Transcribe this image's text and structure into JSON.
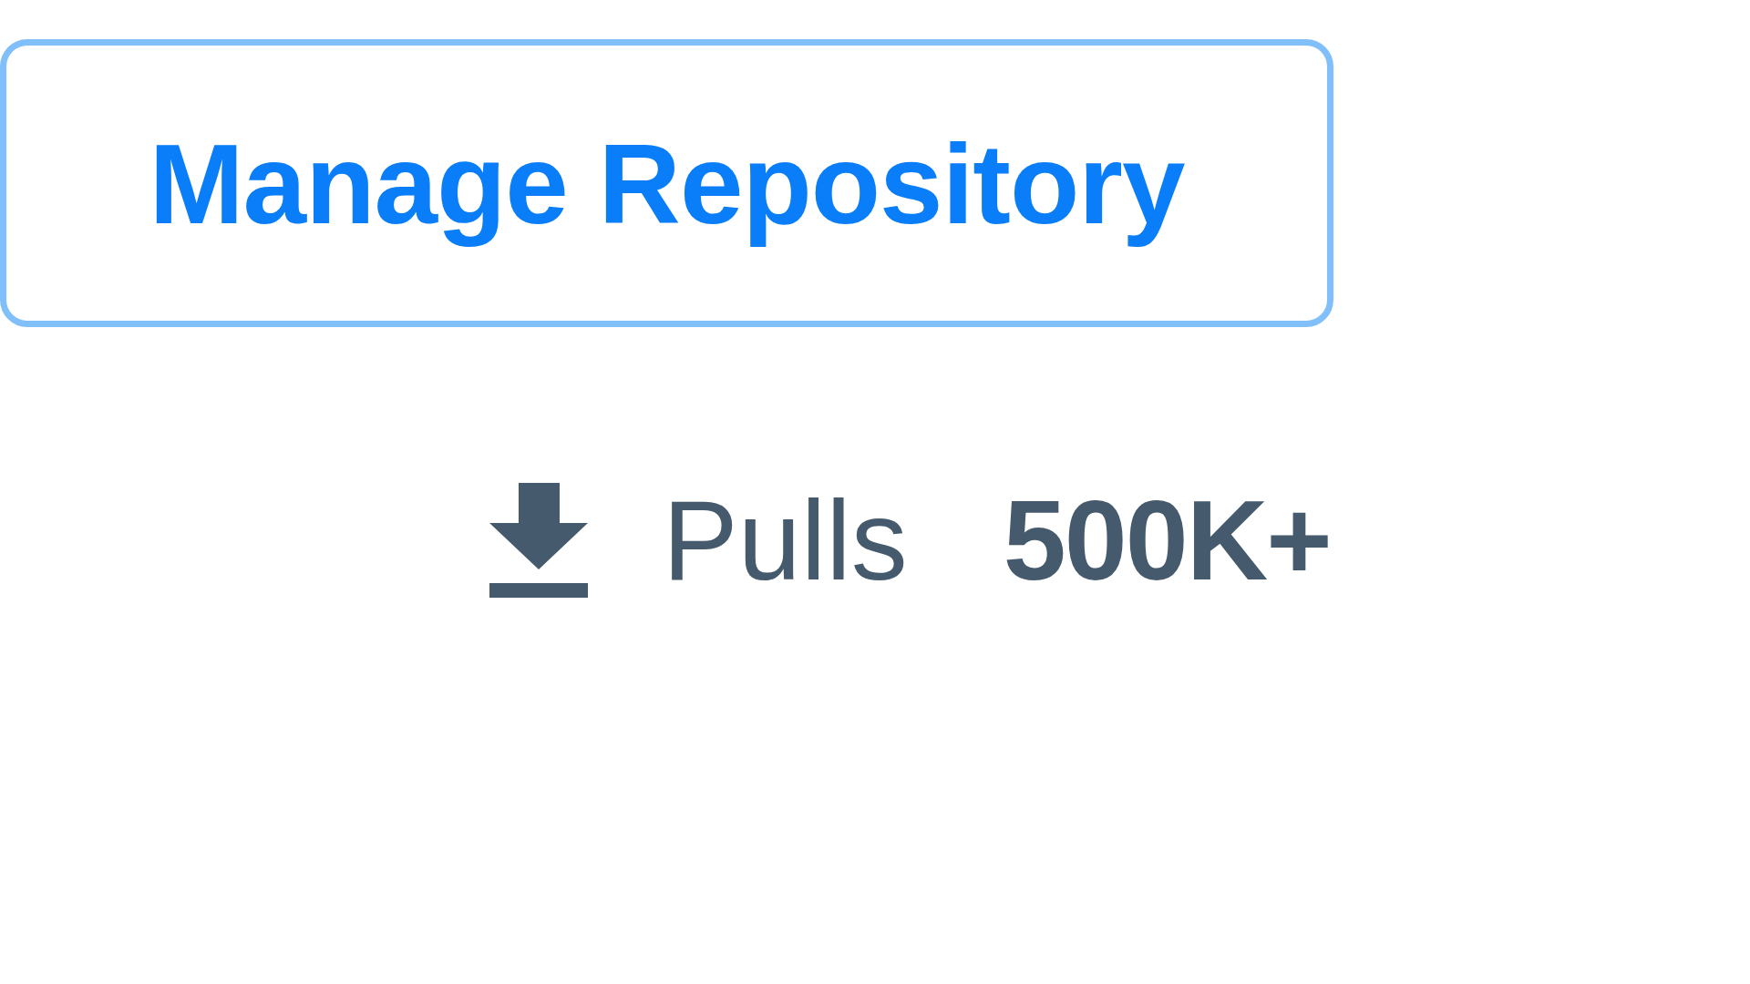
{
  "button": {
    "label": "Manage Repository"
  },
  "stats": [
    {
      "label": "Pulls",
      "value": "500K+"
    }
  ]
}
